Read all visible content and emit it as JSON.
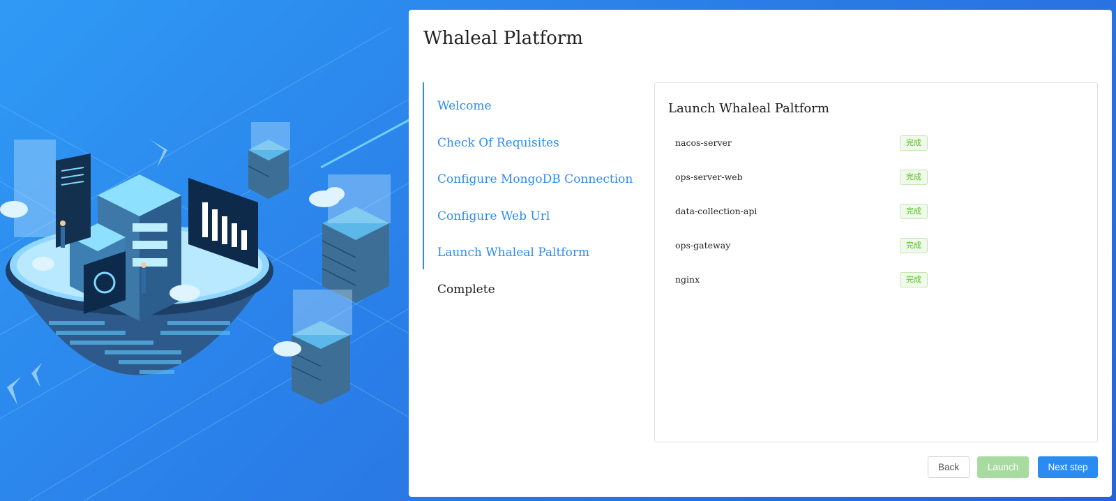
{
  "app": {
    "title": "Whaleal Platform"
  },
  "steps": [
    {
      "label": "Welcome",
      "state": "done"
    },
    {
      "label": "Check Of Requisites",
      "state": "done"
    },
    {
      "label": "Configure MongoDB Connection",
      "state": "done"
    },
    {
      "label": "Configure Web Url",
      "state": "done"
    },
    {
      "label": "Launch Whaleal Paltform",
      "state": "current"
    },
    {
      "label": "Complete",
      "state": "pending"
    }
  ],
  "panel": {
    "title": "Launch Whaleal Paltform",
    "services": [
      {
        "name": "nacos-server",
        "status": "完成"
      },
      {
        "name": "ops-server-web",
        "status": "完成"
      },
      {
        "name": "data-collection-api",
        "status": "完成"
      },
      {
        "name": "ops-gateway",
        "status": "完成"
      },
      {
        "name": "nginx",
        "status": "完成"
      }
    ]
  },
  "buttons": {
    "back": "Back",
    "launch": "Launch",
    "next": "Next step"
  },
  "colors": {
    "accent": "#2a8cf0",
    "success": "#52c41a",
    "background_start": "#2f9af5",
    "background_end": "#2763d8"
  },
  "icons": {
    "hero": "isometric-data-center-illustration"
  }
}
